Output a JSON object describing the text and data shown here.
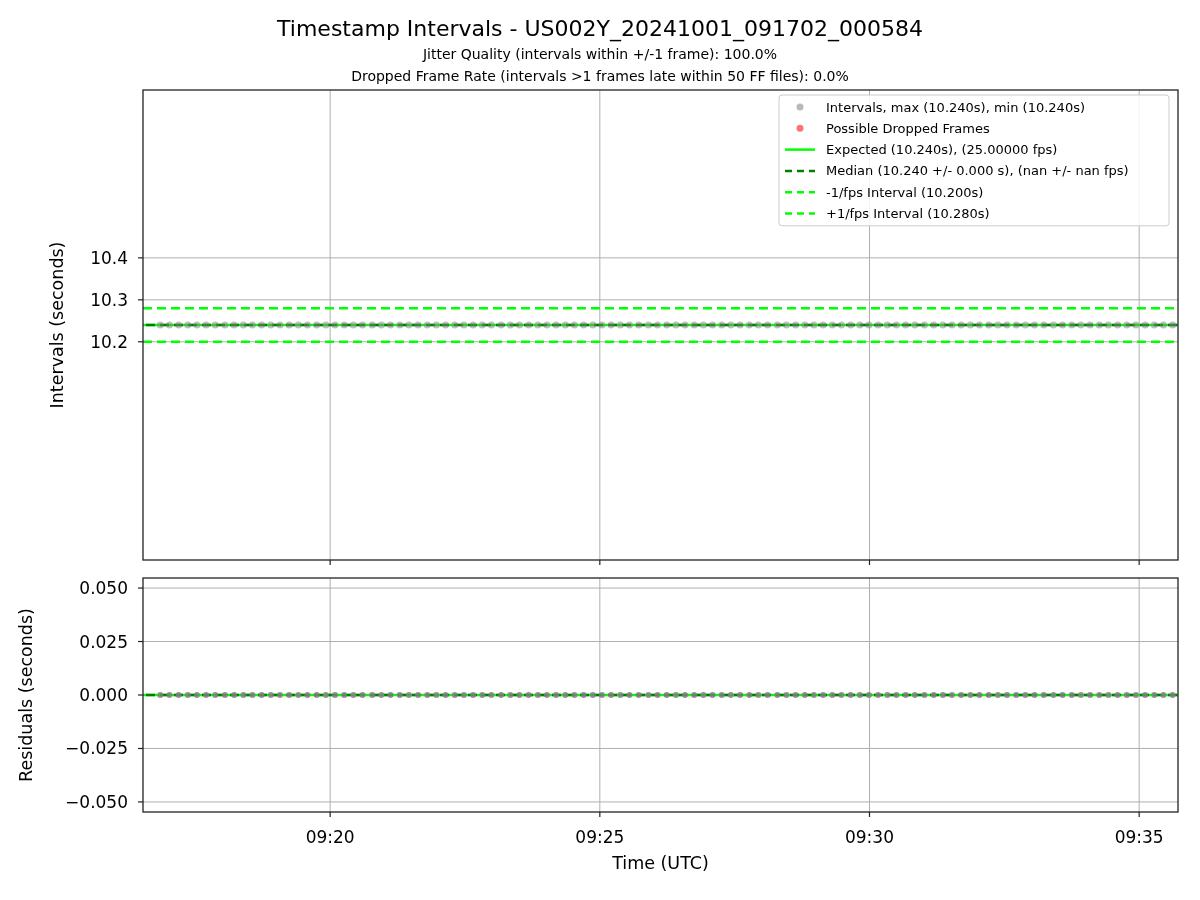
{
  "figure": {
    "title": "Timestamp Intervals - US002Y_20241001_091702_000584",
    "subtitles": [
      "Jitter Quality (intervals within +/-1 frame): 100.0%",
      "Dropped Frame Rate (intervals >1 frames late within 50 FF files): 0.0%"
    ]
  },
  "panels": [
    {
      "chart_data": {
        "type": "scatter",
        "ylabel": "Intervals (seconds)",
        "xlim": [
          556.53,
          575.72
        ],
        "ylim": [
          9.68,
          10.8
        ],
        "yticks": [
          {
            "value": 10.2,
            "label": "10.2"
          },
          {
            "value": 10.3,
            "label": "10.3"
          },
          {
            "value": 10.4,
            "label": "10.4"
          }
        ],
        "x": [
          556.85,
          557.02,
          557.19,
          557.36,
          557.53,
          557.7,
          557.87,
          558.05,
          558.22,
          558.39,
          558.56,
          558.73,
          558.9,
          559.07,
          559.24,
          559.41,
          559.58,
          559.75,
          559.92,
          560.09,
          560.26,
          560.43,
          560.6,
          560.78,
          560.95,
          561.12,
          561.29,
          561.46,
          561.63,
          561.8,
          561.97,
          562.14,
          562.31,
          562.48,
          562.65,
          562.82,
          562.99,
          563.17,
          563.34,
          563.51,
          563.68,
          563.85,
          564.02,
          564.19,
          564.36,
          564.53,
          564.7,
          564.87,
          565.04,
          565.21,
          565.38,
          565.55,
          565.72,
          565.9,
          566.07,
          566.24,
          566.41,
          566.58,
          566.75,
          566.92,
          567.09,
          567.26,
          567.43,
          567.6,
          567.77,
          567.94,
          568.11,
          568.29,
          568.46,
          568.63,
          568.8,
          568.97,
          569.14,
          569.31,
          569.48,
          569.65,
          569.82,
          569.99,
          570.16,
          570.33,
          570.5,
          570.67,
          570.84,
          571.02,
          571.19,
          571.36,
          571.53,
          571.7,
          571.87,
          572.04,
          572.21,
          572.38,
          572.55,
          572.72,
          572.89,
          573.06,
          573.23,
          573.41,
          573.58,
          573.75,
          573.92,
          574.09,
          574.26,
          574.43,
          574.6,
          574.77,
          574.94,
          575.11,
          575.28,
          575.45,
          575.62
        ],
        "series": [
          {
            "name": "Intervals, max (10.240s), min (10.240s)",
            "color": "#808080",
            "values": [
              10.24,
              10.24,
              10.24,
              10.24,
              10.24,
              10.24,
              10.24,
              10.24,
              10.24,
              10.24,
              10.24,
              10.24,
              10.24,
              10.24,
              10.24,
              10.24,
              10.24,
              10.24,
              10.24,
              10.24,
              10.24,
              10.24,
              10.24,
              10.24,
              10.24,
              10.24,
              10.24,
              10.24,
              10.24,
              10.24,
              10.24,
              10.24,
              10.24,
              10.24,
              10.24,
              10.24,
              10.24,
              10.24,
              10.24,
              10.24,
              10.24,
              10.24,
              10.24,
              10.24,
              10.24,
              10.24,
              10.24,
              10.24,
              10.24,
              10.24,
              10.24,
              10.24,
              10.24,
              10.24,
              10.24,
              10.24,
              10.24,
              10.24,
              10.24,
              10.24,
              10.24,
              10.24,
              10.24,
              10.24,
              10.24,
              10.24,
              10.24,
              10.24,
              10.24,
              10.24,
              10.24,
              10.24,
              10.24,
              10.24,
              10.24,
              10.24,
              10.24,
              10.24,
              10.24,
              10.24,
              10.24,
              10.24,
              10.24,
              10.24,
              10.24,
              10.24,
              10.24,
              10.24,
              10.24,
              10.24,
              10.24,
              10.24,
              10.24,
              10.24,
              10.24,
              10.24,
              10.24,
              10.24,
              10.24,
              10.24,
              10.24,
              10.24,
              10.24,
              10.24,
              10.24,
              10.24,
              10.24,
              10.24,
              10.24,
              10.24,
              10.24
            ]
          },
          {
            "name": "Possible Dropped Frames",
            "color": "#ff0000",
            "values": [
              null,
              null,
              null,
              null,
              null,
              null,
              null,
              null,
              null,
              null,
              null,
              null,
              null,
              null,
              null,
              null,
              null,
              null,
              null,
              null,
              null,
              null,
              null,
              null,
              null,
              null,
              null,
              null,
              null,
              null,
              null,
              null,
              null,
              null,
              null,
              null,
              null,
              null,
              null,
              null,
              null,
              null,
              null,
              null,
              null,
              null,
              null,
              null,
              null,
              null,
              null,
              null,
              null,
              null,
              null,
              null,
              null,
              null,
              null,
              null,
              null,
              null,
              null,
              null,
              null,
              null,
              null,
              null,
              null,
              null,
              null,
              null,
              null,
              null,
              null,
              null,
              null,
              null,
              null,
              null,
              null,
              null,
              null,
              null,
              null,
              null,
              null,
              null,
              null,
              null,
              null,
              null,
              null,
              null,
              null,
              null,
              null,
              null,
              null,
              null,
              null,
              null,
              null,
              null,
              null,
              null,
              null,
              null,
              null,
              null,
              null
            ]
          }
        ],
        "legend": "upper right",
        "ref_lines": [
          {
            "axis": "y",
            "value": 10.24,
            "label": "Expected (10.240s), (25.00000 fps)",
            "color": "#00ff00"
          },
          {
            "axis": "y",
            "value": 10.24,
            "label": "Median (10.240 +/- 0.000 s), (nan +/- nan fps)",
            "color": "#008000"
          },
          {
            "axis": "y",
            "value": 10.2,
            "label": "-1/fps Interval (10.200s)",
            "color": "#00ff00"
          },
          {
            "axis": "y",
            "value": 10.28,
            "label": "+1/fps Interval (10.280s)",
            "color": "#00ff00"
          }
        ],
        "grid": true
      }
    },
    {
      "chart_data": {
        "type": "scatter",
        "xlabel": "Time (UTC)",
        "ylabel": "Residuals (seconds)",
        "xlim": [
          556.53,
          575.72
        ],
        "ylim": [
          -0.0547,
          0.0547
        ],
        "x": [
          556.85,
          557.02,
          557.19,
          557.36,
          557.53,
          557.7,
          557.87,
          558.05,
          558.22,
          558.39,
          558.56,
          558.73,
          558.9,
          559.07,
          559.24,
          559.41,
          559.58,
          559.75,
          559.92,
          560.09,
          560.26,
          560.43,
          560.6,
          560.78,
          560.95,
          561.12,
          561.29,
          561.46,
          561.63,
          561.8,
          561.97,
          562.14,
          562.31,
          562.48,
          562.65,
          562.82,
          562.99,
          563.17,
          563.34,
          563.51,
          563.68,
          563.85,
          564.02,
          564.19,
          564.36,
          564.53,
          564.7,
          564.87,
          565.04,
          565.21,
          565.38,
          565.55,
          565.72,
          565.9,
          566.07,
          566.24,
          566.41,
          566.58,
          566.75,
          566.92,
          567.09,
          567.26,
          567.43,
          567.6,
          567.77,
          567.94,
          568.11,
          568.29,
          568.46,
          568.63,
          568.8,
          568.97,
          569.14,
          569.31,
          569.48,
          569.65,
          569.82,
          569.99,
          570.16,
          570.33,
          570.5,
          570.67,
          570.84,
          571.02,
          571.19,
          571.36,
          571.53,
          571.7,
          571.87,
          572.04,
          572.21,
          572.38,
          572.55,
          572.72,
          572.89,
          573.06,
          573.23,
          573.41,
          573.58,
          573.75,
          573.92,
          574.09,
          574.26,
          574.43,
          574.6,
          574.77,
          574.94,
          575.11,
          575.28,
          575.45,
          575.62
        ],
        "xticks": [
          {
            "value": 560,
            "label": "09:20"
          },
          {
            "value": 565,
            "label": "09:25"
          },
          {
            "value": 570,
            "label": "09:30"
          },
          {
            "value": 575,
            "label": "09:35"
          }
        ],
        "yticks": [
          {
            "value": 0.05,
            "label": "0.050"
          },
          {
            "value": 0.025,
            "label": "0.025"
          },
          {
            "value": 0,
            "label": "0.000"
          },
          {
            "value": -0.025,
            "label": "−0.025"
          },
          {
            "value": -0.05,
            "label": "−0.050"
          }
        ],
        "series": [
          {
            "color": "#808080",
            "values": [
              0,
              0,
              0,
              0,
              0,
              0,
              0,
              0,
              0,
              0,
              0,
              0,
              0,
              0,
              0,
              0,
              0,
              0,
              0,
              0,
              0,
              0,
              0,
              0,
              0,
              0,
              0,
              0,
              0,
              0,
              0,
              0,
              0,
              0,
              0,
              0,
              0,
              0,
              0,
              0,
              0,
              0,
              0,
              0,
              0,
              0,
              0,
              0,
              0,
              0,
              0,
              0,
              0,
              0,
              0,
              0,
              0,
              0,
              0,
              0,
              0,
              0,
              0,
              0,
              0,
              0,
              0,
              0,
              0,
              0,
              0,
              0,
              0,
              0,
              0,
              0,
              0,
              0,
              0,
              0,
              0,
              0,
              0,
              0,
              0,
              0,
              0,
              0,
              0,
              0,
              0,
              0,
              0,
              0,
              0,
              0,
              0,
              0,
              0,
              0,
              0,
              0,
              0,
              0,
              0,
              0,
              0,
              0,
              0,
              0,
              0
            ]
          }
        ],
        "ref_lines": [
          {
            "axis": "y",
            "value": 0,
            "color": "#00ff00"
          },
          {
            "axis": "y",
            "value": 0,
            "color": "#008000"
          }
        ],
        "grid": true
      }
    }
  ]
}
